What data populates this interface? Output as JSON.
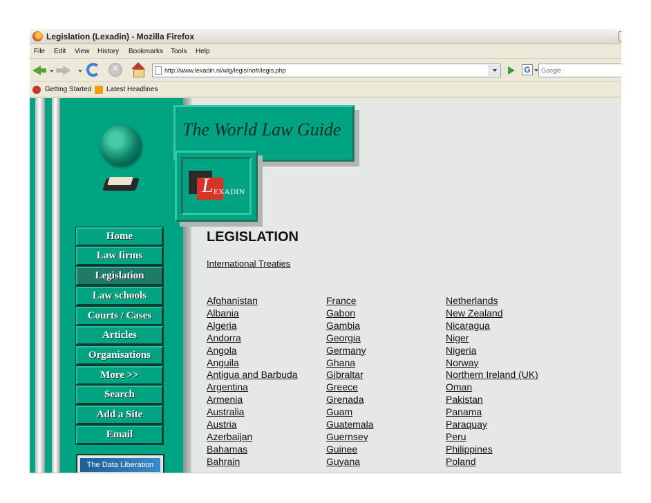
{
  "window": {
    "title": "Legislation (Lexadin) - Mozilla Firefox"
  },
  "menu": [
    "File",
    "Edit",
    "View",
    "History",
    "Bookmarks",
    "Tools",
    "Help"
  ],
  "toolbar": {
    "url": "http://www.lexadin.nl/wlg/legis/nofr/legis.php",
    "search_engine_letter": "G",
    "search_placeholder": "Google"
  },
  "bookmarks": {
    "getting_started": "Getting Started",
    "latest_headlines": "Latest Headlines"
  },
  "site": {
    "banner_title": "The World Law Guide",
    "logo_letter": "L",
    "logo_text": "EXADIN",
    "nav": [
      "Home",
      "Law firms",
      "Legislation",
      "Law schools",
      "Courts / Cases",
      "Articles",
      "Organisations",
      "More >>",
      "Search",
      "Add a Site",
      "Email"
    ],
    "nav_active_index": 2,
    "data_liberation": "The Data Liberation"
  },
  "main": {
    "heading": "LEGISLATION",
    "treaties_link": "International Treaties",
    "countries": [
      [
        "Afghanistan",
        "Albania",
        "Algeria",
        "Andorra",
        "Angola",
        "Anguila",
        "Antigua and Barbuda",
        "Argentina",
        "Armenia",
        "Australia",
        "Austria",
        "Azerbaijan",
        "Bahamas",
        "Bahrain"
      ],
      [
        "France",
        "Gabon",
        "Gambia",
        "Georgia",
        "Germany",
        "Ghana",
        "Gibraltar",
        "Greece",
        "Grenada",
        "Guam",
        "Guatemala",
        "Guernsey",
        "Guinee",
        "Guyana"
      ],
      [
        "Netherlands",
        "New Zealand",
        "Nicaragua",
        "Niger",
        "Nigeria",
        "Norway",
        "Northern Ireland (UK)",
        "Oman",
        "Pakistan",
        "Panama",
        "Paraquay",
        "Peru",
        "Philippines",
        "Poland"
      ]
    ]
  },
  "colors": {
    "sidebar_teal": "#00a382",
    "page_background": "#e6e8e6",
    "chrome": "#ece9d8"
  }
}
